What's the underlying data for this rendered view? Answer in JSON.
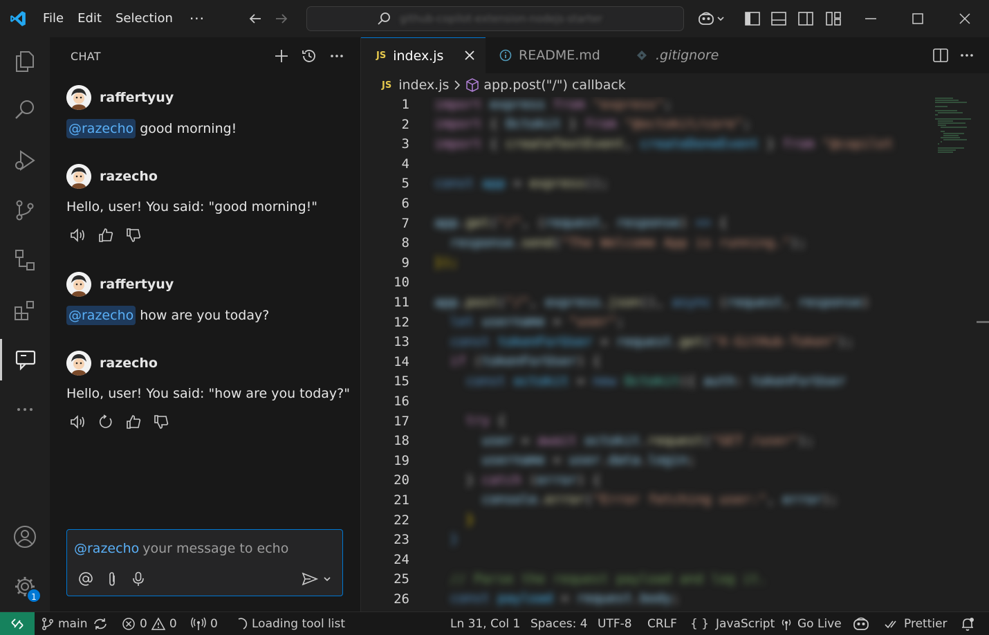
{
  "menu": {
    "file": "File",
    "edit": "Edit",
    "selection": "Selection",
    "more": "···"
  },
  "search": {
    "placeholder_blurred": "github-copilot-extension-nodejs-starter"
  },
  "chat": {
    "header": "CHAT",
    "messages": [
      {
        "user": "raffertyuy",
        "mention": "@razecho",
        "text": "good morning!"
      },
      {
        "user": "razecho",
        "text": "Hello, user! You said: \"good morning!\""
      },
      {
        "user": "raffertyuy",
        "mention": "@razecho",
        "text": "how are you today?"
      },
      {
        "user": "razecho",
        "text": "Hello, user! You said: \"how are you today?\""
      }
    ],
    "input": {
      "mention": "@razecho",
      "placeholder": "your message to echo"
    }
  },
  "tabs": [
    {
      "label": "index.js",
      "badge": "JS"
    },
    {
      "label": "README.md"
    },
    {
      "label": ".gitignore"
    }
  ],
  "breadcrumb": {
    "file": "index.js",
    "symbol": "app.post(\"/\") callback",
    "badge": "JS"
  },
  "editor": {
    "line_numbers": [
      "1",
      "2",
      "3",
      "4",
      "5",
      "6",
      "7",
      "8",
      "9",
      "10",
      "11",
      "12",
      "13",
      "14",
      "15",
      "16",
      "17",
      "18",
      "19",
      "20",
      "21",
      "22",
      "23",
      "24",
      "25",
      "26"
    ]
  },
  "activity_badge": "1",
  "status": {
    "branch": "main",
    "errors": "0",
    "warnings": "0",
    "ports": "0",
    "loading": "Loading tool list",
    "position": "Ln 31, Col 1",
    "spaces": "Spaces: 4",
    "encoding": "UTF-8",
    "eol": "CRLF",
    "language": "JavaScript",
    "language_icon": "{ }",
    "golive": "Go Live",
    "prettier": "Prettier"
  },
  "colors": {
    "accent": "#0078d4",
    "remote": "#16825d",
    "mention": "#5ab0f7",
    "js": "#e5c84d"
  }
}
